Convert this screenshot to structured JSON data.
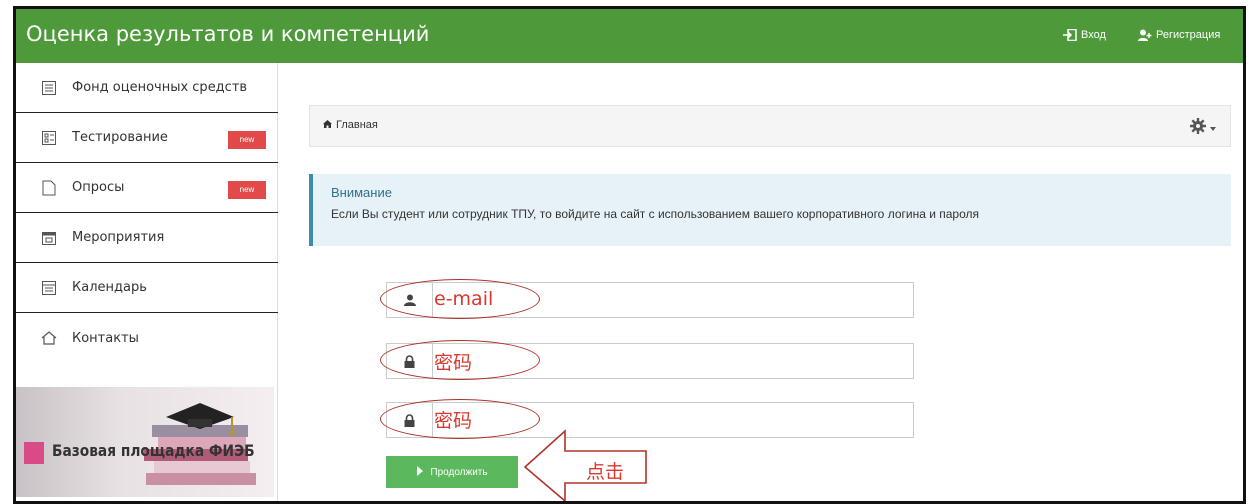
{
  "header": {
    "brand": "Оценка результатов и компетенций",
    "login_label": "Вход",
    "register_label": "Регистрация"
  },
  "sidebar": {
    "items": [
      {
        "label": "Фонд оценочных средств",
        "icon": "list-icon"
      },
      {
        "label": "Тестирование",
        "icon": "test-icon",
        "badge": "new"
      },
      {
        "label": "Опросы",
        "icon": "survey-icon",
        "badge": "new"
      },
      {
        "label": "Мероприятия",
        "icon": "calendar-icon"
      },
      {
        "label": "Календарь",
        "icon": "calendar-list-icon"
      },
      {
        "label": "Контакты",
        "icon": "home-icon"
      }
    ],
    "banner_text": "Базовая площадка ФИЭБ"
  },
  "breadcrumb": {
    "home_label": "Главная"
  },
  "alert": {
    "title": "Внимание",
    "text": "Если Вы студент или сотрудник ТПУ, то войдите на сайт с использованием вашего корпоративного логина и пароля"
  },
  "form": {
    "email_hint": "e-mail",
    "password_hint": "密码",
    "password_confirm_hint": "密码",
    "email_value": "",
    "password_value": "",
    "password_confirm_value": "",
    "submit_label": "Продолжить"
  },
  "annotation": {
    "callout_label": "点击"
  },
  "colors": {
    "header_bg": "#4e9a3a",
    "badge_bg": "#e24a4a",
    "alert_bg": "#e6f2f7",
    "alert_border": "#3a8dab",
    "submit_bg": "#5cb85c",
    "annotation": "#d9382e"
  }
}
